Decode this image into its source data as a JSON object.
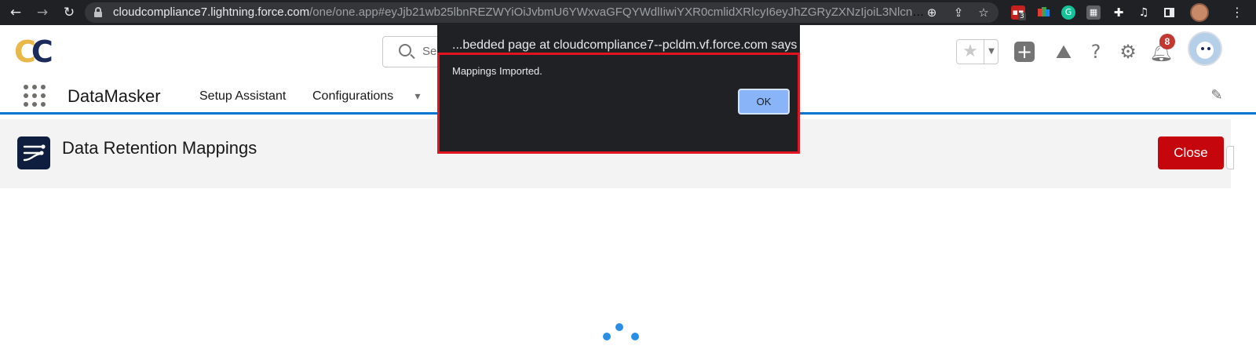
{
  "browser": {
    "url_host": "cloudcompliance7.lightning.force.com",
    "url_path": "/one/one.app#eyJjb21wb25lbnREZWYiOiJvbmU6YWxvaGFQYWdlIiwiYXR0cmlidXRlcyI6eyJhZGRyZXNzIjoiL3NlcnZsZXQvc2...",
    "extension_badge": "3",
    "icons": [
      "back-arrow-icon",
      "forward-arrow-icon",
      "reload-icon",
      "lock-icon",
      "zoom-icon",
      "share-icon",
      "bookmark-star-icon",
      "puzzle-icon",
      "media-icon",
      "sidepanel-icon",
      "kebab-icon"
    ]
  },
  "header": {
    "logo_letters": [
      "C",
      "C"
    ],
    "search_placeholder": "Se",
    "notifications_count": "8",
    "icons": [
      "favorite-star-icon",
      "add-icon",
      "trailhead-icon",
      "help-icon",
      "setup-gear-icon",
      "bell-icon"
    ]
  },
  "app_nav": {
    "app_name": "DataMasker",
    "items": [
      {
        "label": "Setup Assistant"
      },
      {
        "label": "Configurations"
      }
    ]
  },
  "page": {
    "title": "Data Retention Mappings",
    "close_label": "Close"
  },
  "dialog": {
    "title": "...bedded page at cloudcompliance7--pcldm.vf.force.com says",
    "message": "Mappings Imported.",
    "ok_label": "OK"
  },
  "colors": {
    "browser_bg": "#202124",
    "brand_blue": "#0176d3",
    "close_red": "#c5060d",
    "highlight_red": "#e0131e",
    "ok_blue": "#8ab4f8",
    "spinner_blue": "#2a8ee6"
  }
}
